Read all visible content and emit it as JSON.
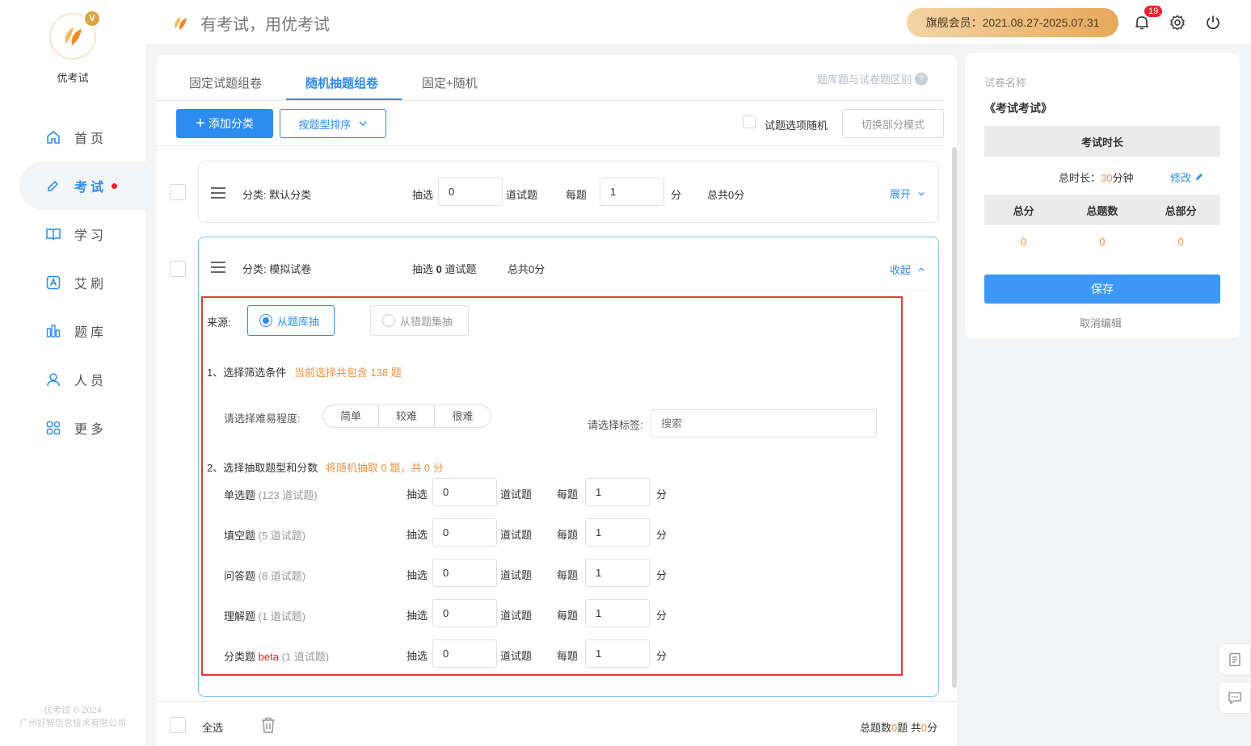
{
  "brand": {
    "name": "优考试",
    "vip_mark": "V",
    "copyright_1": "优考试 © 2024",
    "copyright_2": "广州好智信息技术有限公司"
  },
  "nav": [
    {
      "label": "首页",
      "icon": "home-icon"
    },
    {
      "label": "考试",
      "icon": "exam-icon",
      "active": true
    },
    {
      "label": "学习",
      "icon": "book-icon"
    },
    {
      "label": "艾刷",
      "icon": "practice-icon"
    },
    {
      "label": "题库",
      "icon": "question-bank-icon"
    },
    {
      "label": "人员",
      "icon": "user-icon"
    },
    {
      "label": "更多",
      "icon": "more-icon"
    }
  ],
  "header": {
    "slogan": "有考试，用优考试",
    "member": "旗舰会员：2021.08.27-2025.07.31",
    "notifications": "19"
  },
  "tabs": [
    "固定试题组卷",
    "随机抽题组卷",
    "固定+随机"
  ],
  "help_text": "题库题与试卷题区别",
  "help_mark": "?",
  "toolbar": {
    "add_category": "添加分类",
    "sort_by_type": "按题型排序",
    "random_options": "试题选项随机",
    "switch_mode": "切换部分模式"
  },
  "category1": {
    "name": "分类: 默认分类",
    "draw_label": "抽选",
    "draw_value": "0",
    "unit_label": "道试题",
    "per_label": "每题",
    "per_value": "1",
    "score_unit": "分",
    "total": "总共0分",
    "toggle": "展开"
  },
  "category2": {
    "name": "分类: 模拟试卷",
    "draw_label": "抽选",
    "draw_count": "0",
    "unit_label": "道试题",
    "total": "总共0分",
    "toggle": "收起",
    "source_label": "来源:",
    "source_bank": "从题库抽",
    "source_wrong": "从错题集抽",
    "step1_label": "1、选择筛选条件",
    "step1_note": "当前选择共包含 138 题",
    "difficulty_label": "请选择难易程度:",
    "difficulty_options": [
      "简单",
      "较难",
      "很难"
    ],
    "tag_label": "请选择标签:",
    "tag_placeholder": "搜索",
    "step2_label": "2、选择抽取题型和分数",
    "step2_note": "将随机抽取 0 题，共 0 分",
    "types": [
      {
        "name": "单选题",
        "beta": "",
        "count": "(123 道试题)",
        "draw": "0",
        "per": "1"
      },
      {
        "name": "填空题",
        "beta": "",
        "count": "(5 道试题)",
        "draw": "0",
        "per": "1"
      },
      {
        "name": "问答题",
        "beta": "",
        "count": "(8 道试题)",
        "draw": "0",
        "per": "1"
      },
      {
        "name": "理解题",
        "beta": "",
        "count": "(1 道试题)",
        "draw": "0",
        "per": "1"
      },
      {
        "name": "分类题",
        "beta": "beta",
        "count": "(1 道试题)",
        "draw": "0",
        "per": "1"
      }
    ],
    "draw_label_row": "抽选",
    "unit_label_row": "道试题",
    "per_label_row": "每题",
    "score_unit_row": "分"
  },
  "footer": {
    "select_all": "全选",
    "summary_prefix": "总题数",
    "summary_count": "0",
    "summary_mid": "题 共",
    "summary_score": "0",
    "summary_suffix": "分"
  },
  "right": {
    "paper_name_label": "试卷名称",
    "paper_name": "《考试考试》",
    "duration_header": "考试时长",
    "duration_prefix": "总时长：",
    "duration_value": "30",
    "duration_unit": "分钟",
    "edit": "修改",
    "cols": [
      "总分",
      "总题数",
      "总部分"
    ],
    "vals": [
      "0",
      "0",
      "0"
    ],
    "save": "保存",
    "cancel": "取消编辑"
  },
  "colors": {
    "accent": "#2d8cf0",
    "warning": "#f0903c",
    "danger": "#e53935"
  }
}
